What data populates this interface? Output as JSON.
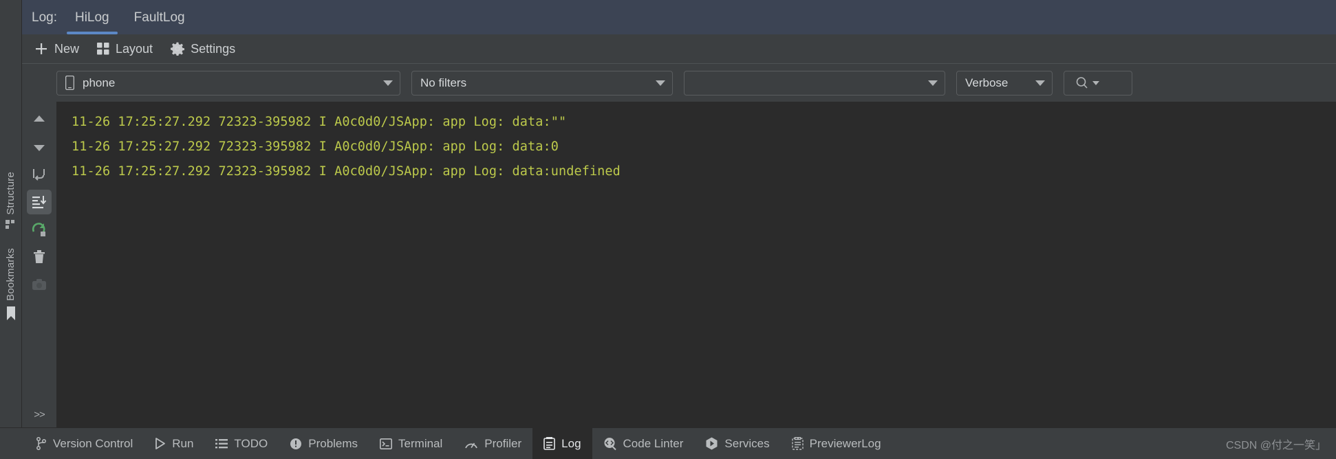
{
  "tabs": {
    "label": "Log:",
    "items": [
      {
        "name": "HiLog",
        "active": true
      },
      {
        "name": "FaultLog",
        "active": false
      }
    ]
  },
  "toolbar": {
    "new_label": "New",
    "layout_label": "Layout",
    "settings_label": "Settings",
    "new_icon": "plus-icon",
    "layout_icon": "grid-icon",
    "settings_icon": "gear-icon"
  },
  "filters": {
    "device": {
      "value": "phone",
      "icon": "phone-icon"
    },
    "filter": {
      "value": "No filters"
    },
    "package": {
      "value": ""
    },
    "level": {
      "value": "Verbose"
    },
    "search": {
      "icon": "search-icon",
      "value": ""
    }
  },
  "gutter": {
    "buttons": [
      {
        "icon": "scroll-up-icon",
        "selected": false
      },
      {
        "icon": "scroll-down-icon",
        "selected": false
      },
      {
        "icon": "soft-wrap-icon",
        "selected": false
      },
      {
        "icon": "scroll-to-end-icon",
        "selected": true
      },
      {
        "icon": "restart-icon",
        "selected": false
      },
      {
        "icon": "clear-all-icon",
        "selected": false
      },
      {
        "icon": "screenshot-icon",
        "selected": false
      }
    ],
    "more_label": ">>"
  },
  "log": {
    "lines": [
      "11-26 17:25:27.292 72323-395982 I A0c0d0/JSApp: app Log: data:\"\"",
      "11-26 17:25:27.292 72323-395982 I A0c0d0/JSApp: app Log: data:0",
      "11-26 17:25:27.292 72323-395982 I A0c0d0/JSApp: app Log: data:undefined"
    ],
    "text_color": "#bcc94b",
    "background": "#2b2b2b"
  },
  "left_rail": {
    "structure_label": "Structure",
    "structure_icon": "structure-icon",
    "bookmarks_label": "Bookmarks",
    "bookmarks_icon": "bookmark-icon"
  },
  "status_bar": {
    "items": [
      {
        "label": "Version Control",
        "icon": "branch-icon",
        "active": false
      },
      {
        "label": "Run",
        "icon": "play-icon",
        "active": false
      },
      {
        "label": "TODO",
        "icon": "list-icon",
        "active": false
      },
      {
        "label": "Problems",
        "icon": "warning-icon",
        "active": false
      },
      {
        "label": "Terminal",
        "icon": "terminal-icon",
        "active": false
      },
      {
        "label": "Profiler",
        "icon": "gauge-icon",
        "active": false
      },
      {
        "label": "Log",
        "icon": "log-icon",
        "active": true
      },
      {
        "label": "Code Linter",
        "icon": "code-search-icon",
        "active": false
      },
      {
        "label": "Services",
        "icon": "services-icon",
        "active": false
      },
      {
        "label": "PreviewerLog",
        "icon": "previewer-log-icon",
        "active": false
      }
    ],
    "watermark": "CSDN @付之一笑」"
  },
  "colors": {
    "accent": "#5c88c5",
    "tab_strip_bg": "#3c4454",
    "panel_bg": "#3c3f41",
    "console_bg": "#2b2b2b",
    "log_green": "#bcc94b",
    "restart_green": "#59a869"
  }
}
